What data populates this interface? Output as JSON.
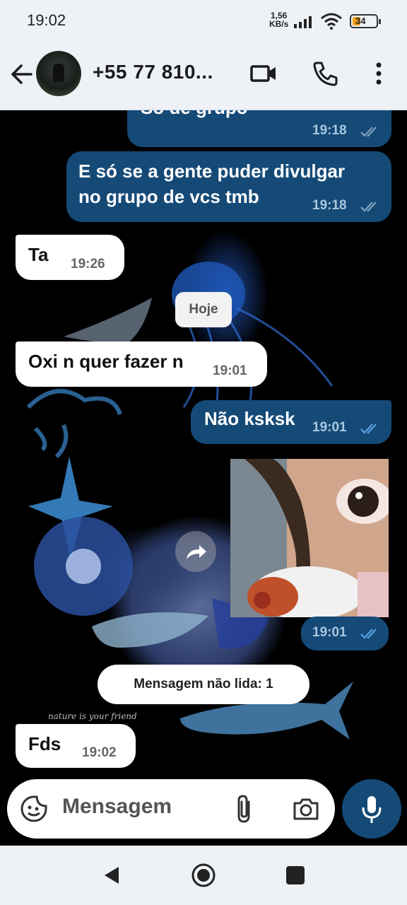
{
  "status_bar": {
    "time": "19:02",
    "net_speed_value": "1,56",
    "net_speed_unit": "KB/s",
    "battery": "34",
    "battery_color": "#f39c12"
  },
  "header": {
    "contact_name": "+55 77 810...",
    "icons": [
      "back-arrow-icon",
      "video-call-icon",
      "phone-icon",
      "more-vert-icon"
    ]
  },
  "messages": [
    {
      "direction": "out",
      "text": "Só de grupo",
      "time": "19:18",
      "status": "read"
    },
    {
      "direction": "out",
      "text_line1": "E só se a gente puder divulgar",
      "text_line2": "no grupo de vcs tmb",
      "time": "19:18",
      "status": "read"
    },
    {
      "direction": "in",
      "text": "Ta",
      "time": "19:26"
    },
    {
      "direction": "in",
      "text": "Oxi n quer fazer n",
      "time": "19:01"
    },
    {
      "direction": "out",
      "text": "Não ksksk",
      "time": "19:01",
      "status": "read"
    },
    {
      "direction": "out",
      "type": "image",
      "time": "19:01",
      "status": "read"
    },
    {
      "direction": "in",
      "text": "Fds",
      "time": "19:02"
    }
  ],
  "date_divider": "Hoje",
  "unread_divider": "Mensagem não lida: 1",
  "wallpaper_caption": "nature is your friend",
  "composer": {
    "placeholder": "Mensagem"
  },
  "colors": {
    "outgoing_bubble": "#154a77",
    "incoming_bubble": "#ffffff",
    "read_ticks": "#5aa0e6"
  }
}
